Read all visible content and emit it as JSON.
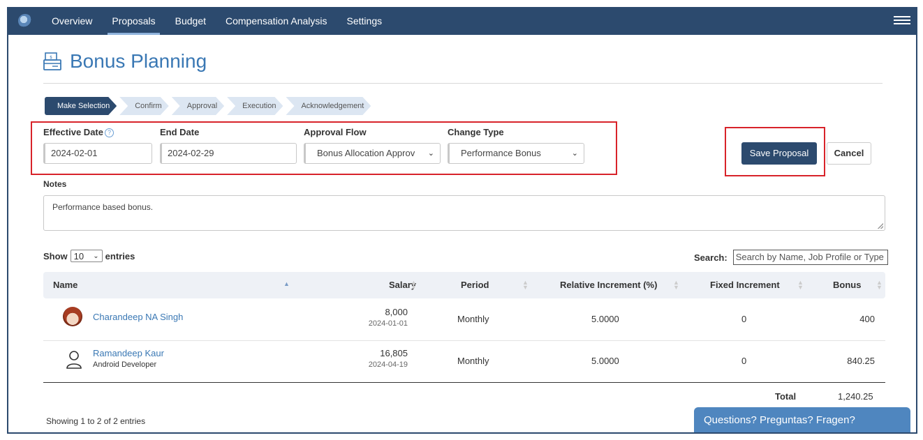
{
  "nav": {
    "items": [
      "Overview",
      "Proposals",
      "Budget",
      "Compensation Analysis",
      "Settings"
    ],
    "active": "Proposals"
  },
  "page": {
    "title": "Bonus Planning"
  },
  "steps": [
    "Make Selection",
    "Confirm",
    "Approval",
    "Execution",
    "Acknowledgement"
  ],
  "form": {
    "effective_date_label": "Effective Date",
    "effective_date_value": "2024-02-01",
    "end_date_label": "End Date",
    "end_date_value": "2024-02-29",
    "approval_flow_label": "Approval Flow",
    "approval_flow_value": "Bonus Allocation Approv",
    "change_type_label": "Change Type",
    "change_type_value": "Performance Bonus",
    "notes_label": "Notes",
    "notes_value": "Performance based bonus."
  },
  "buttons": {
    "save": "Save Proposal",
    "cancel": "Cancel"
  },
  "table": {
    "show_label": "Show",
    "entries_label": "entries",
    "page_length": "10",
    "search_label": "Search:",
    "search_placeholder": "Search by Name, Job Profile or Type",
    "columns": [
      "Name",
      "Salary",
      "Period",
      "Relative Increment (%)",
      "Fixed Increment",
      "Bonus"
    ],
    "rows": [
      {
        "name": "Charandeep NA Singh",
        "job": "",
        "salary": "8,000",
        "salary_date": "2024-01-01",
        "period": "Monthly",
        "relative": "5.0000",
        "fixed": "0",
        "bonus": "400"
      },
      {
        "name": "Ramandeep Kaur",
        "job": "Android Developer",
        "salary": "16,805",
        "salary_date": "2024-04-19",
        "period": "Monthly",
        "relative": "5.0000",
        "fixed": "0",
        "bonus": "840.25"
      }
    ],
    "total_label": "Total",
    "total_value": "1,240.25",
    "info": "Showing 1 to 2 of 2 entries"
  },
  "chat": {
    "label": "Questions? Preguntas? Fragen?"
  },
  "colors": {
    "nav_bg": "#2c4a6e",
    "accent": "#3a78b4",
    "highlight": "#d8232a"
  }
}
